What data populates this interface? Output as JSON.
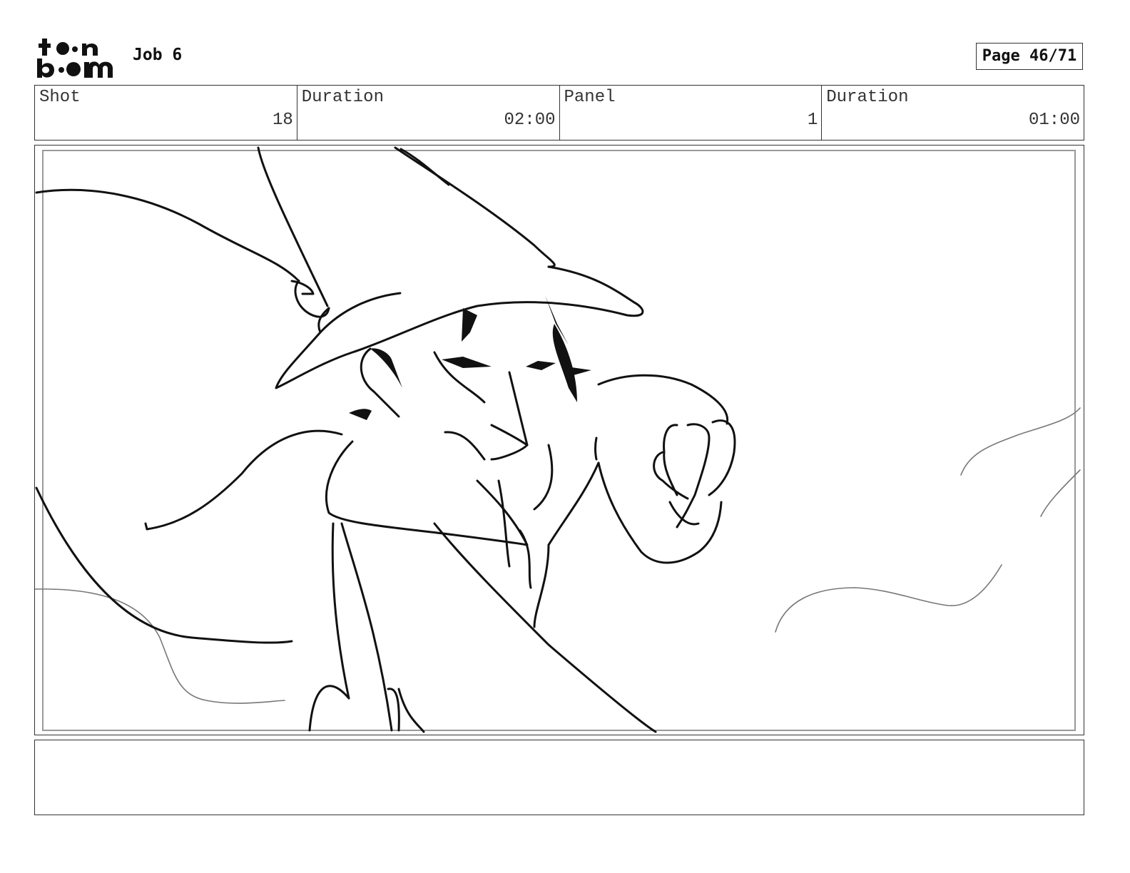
{
  "header": {
    "logo_text": "toon boom",
    "job_title": "Job 6",
    "page_label": "Page 46/71"
  },
  "info": {
    "shot_label": "Shot",
    "shot_value": "18",
    "shot_duration_label": "Duration",
    "shot_duration_value": "02:00",
    "panel_label": "Panel",
    "panel_value": "1",
    "panel_duration_label": "Duration",
    "panel_duration_value": "01:00"
  },
  "notes": {
    "text": ""
  }
}
